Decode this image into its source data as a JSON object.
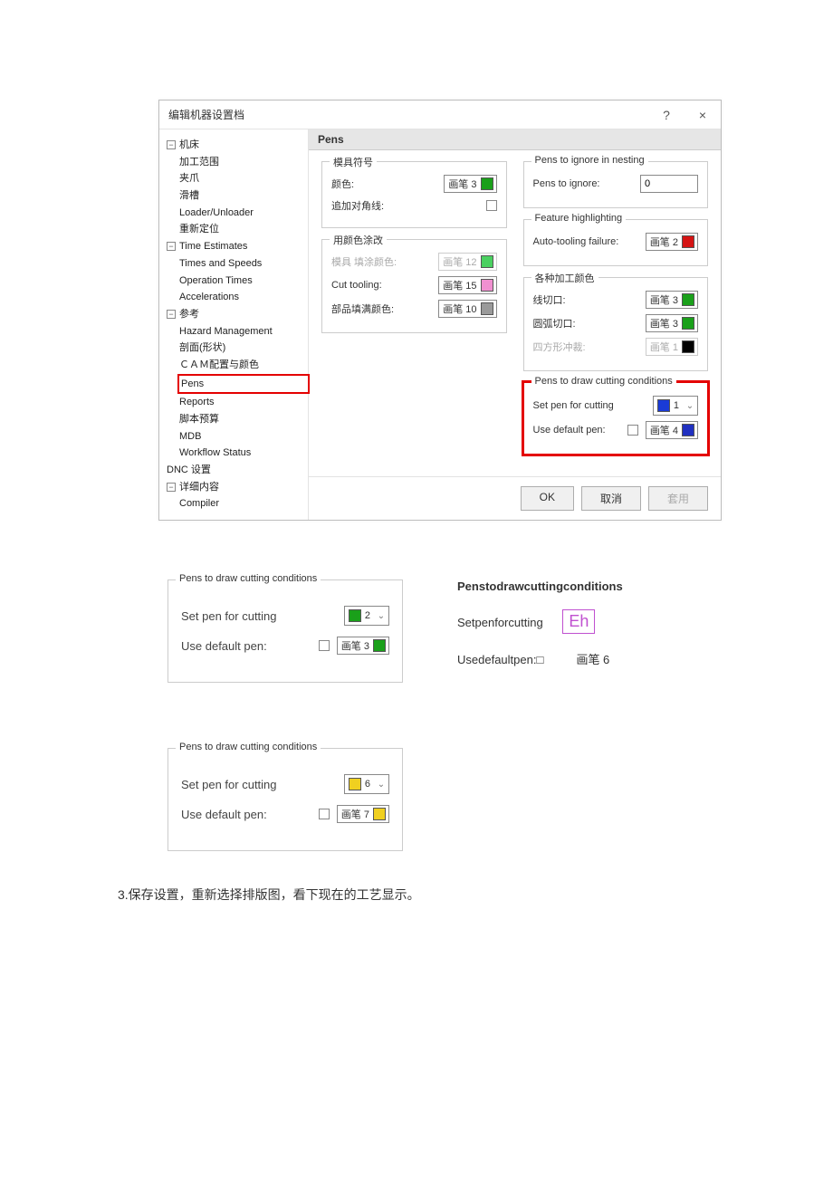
{
  "colors": {
    "pen1": "#1a3bd6",
    "pen2": "#d41414",
    "pen3": "#1aa01a",
    "pen4": "#2030c0",
    "pen6": "#f0d020",
    "pen7": "#f0d020",
    "pen10": "#9a9a9a",
    "pen12": "#4ad060",
    "pen15": "#f090d0",
    "black": "#000000"
  },
  "dialog": {
    "title": "编辑机器设置档",
    "help": "?",
    "close": "×"
  },
  "tree": {
    "n1": "机床",
    "n1_1": "加工范围",
    "n1_2": "夹爪",
    "n1_3": "滑槽",
    "n1_4": "Loader/Unloader",
    "n1_5": "重新定位",
    "n2": "Time Estimates",
    "n2_1": "Times and Speeds",
    "n2_2": "Operation Times",
    "n2_3": "Accelerations",
    "n3": "参考",
    "n3_1": "Hazard Management",
    "n3_2": "剖面(形状)",
    "n3_3": "ＣＡＭ配置与颜色",
    "n3_4": "Pens",
    "n3_5": "Reports",
    "n3_6": "脚本预算",
    "n3_7": "MDB",
    "n3_8": "Workflow Status",
    "n4": "DNC 设置",
    "n5": "详细内容",
    "n5_1": "Compiler"
  },
  "panel": {
    "header": "Pens",
    "g1_title": "模具符号",
    "g1_color_lbl": "颜色:",
    "g1_color_val": "画笔 3",
    "g1_diag_lbl": "追加对角线:",
    "g2_title": "用颜色涂改",
    "g2_fill_lbl": "模具 填涂颜色:",
    "g2_fill_val": "画笔 12",
    "g2_cut_lbl": "Cut tooling:",
    "g2_cut_val": "画笔 15",
    "g2_part_lbl": "部品填满颜色:",
    "g2_part_val": "画笔 10",
    "g3_title": "Pens to ignore in nesting",
    "g3_lbl": "Pens to ignore:",
    "g3_val": "0",
    "g4_title": "Feature highlighting",
    "g4_lbl": "Auto-tooling failure:",
    "g4_val": "画笔 2",
    "g5_title": "各种加工颜色",
    "g5_line_lbl": "线切口:",
    "g5_line_val": "画笔 3",
    "g5_arc_lbl": "圆弧切口:",
    "g5_arc_val": "画笔 3",
    "g5_sq_lbl": "四方形冲裁:",
    "g5_sq_val": "画笔 1",
    "g6_title": "Pens to draw cutting conditions",
    "g6_set_lbl": "Set pen for cutting",
    "g6_set_val": "1",
    "g6_def_lbl": "Use default pen:",
    "g6_def_val": "画笔 4"
  },
  "buttons": {
    "ok": "OK",
    "cancel": "取消",
    "apply": "套用"
  },
  "snips": {
    "a": {
      "title": "Pens to draw cutting conditions",
      "set_lbl": "Set pen for cutting",
      "set_val": "2",
      "def_lbl": "Use default pen:",
      "def_val": "画笔 3"
    },
    "b": {
      "title": "Penstodrawcuttingconditions",
      "set_lbl": "Setpenforcutting",
      "set_val": "Eh",
      "def_lbl": "Usedefaultpen:□",
      "def_val": "画笔 6"
    },
    "c": {
      "title": "Pens to draw cutting conditions",
      "set_lbl": "Set pen for cutting",
      "set_val": "6",
      "def_lbl": "Use default pen:",
      "def_val": "画笔 7"
    }
  },
  "step3": "3.保存设置，重新选择排版图，看下现在的工艺显示。"
}
